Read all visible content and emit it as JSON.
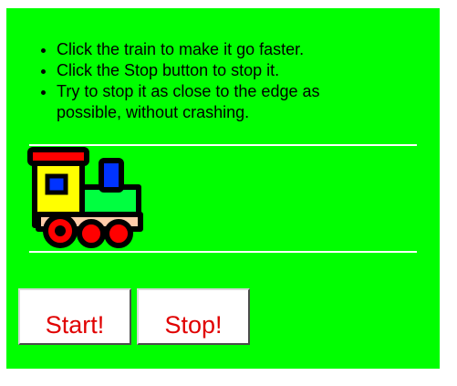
{
  "instructions": [
    "Click the train to make it go faster.",
    "Click the Stop button to stop it.",
    "Try to stop it as close to the edge as possible, without crashing."
  ],
  "train": {
    "icon": "train-icon"
  },
  "buttons": {
    "start_label": "Start!",
    "stop_label": "Stop!"
  },
  "colors": {
    "panel": "#00ff00",
    "button_text": "#e00000",
    "track_line": "#ffffff",
    "train_cab": "#ffff00",
    "train_body": "#00ff40",
    "train_roof": "#ff0000",
    "train_window": "#0033ff",
    "train_wheels": "#ff0000"
  }
}
